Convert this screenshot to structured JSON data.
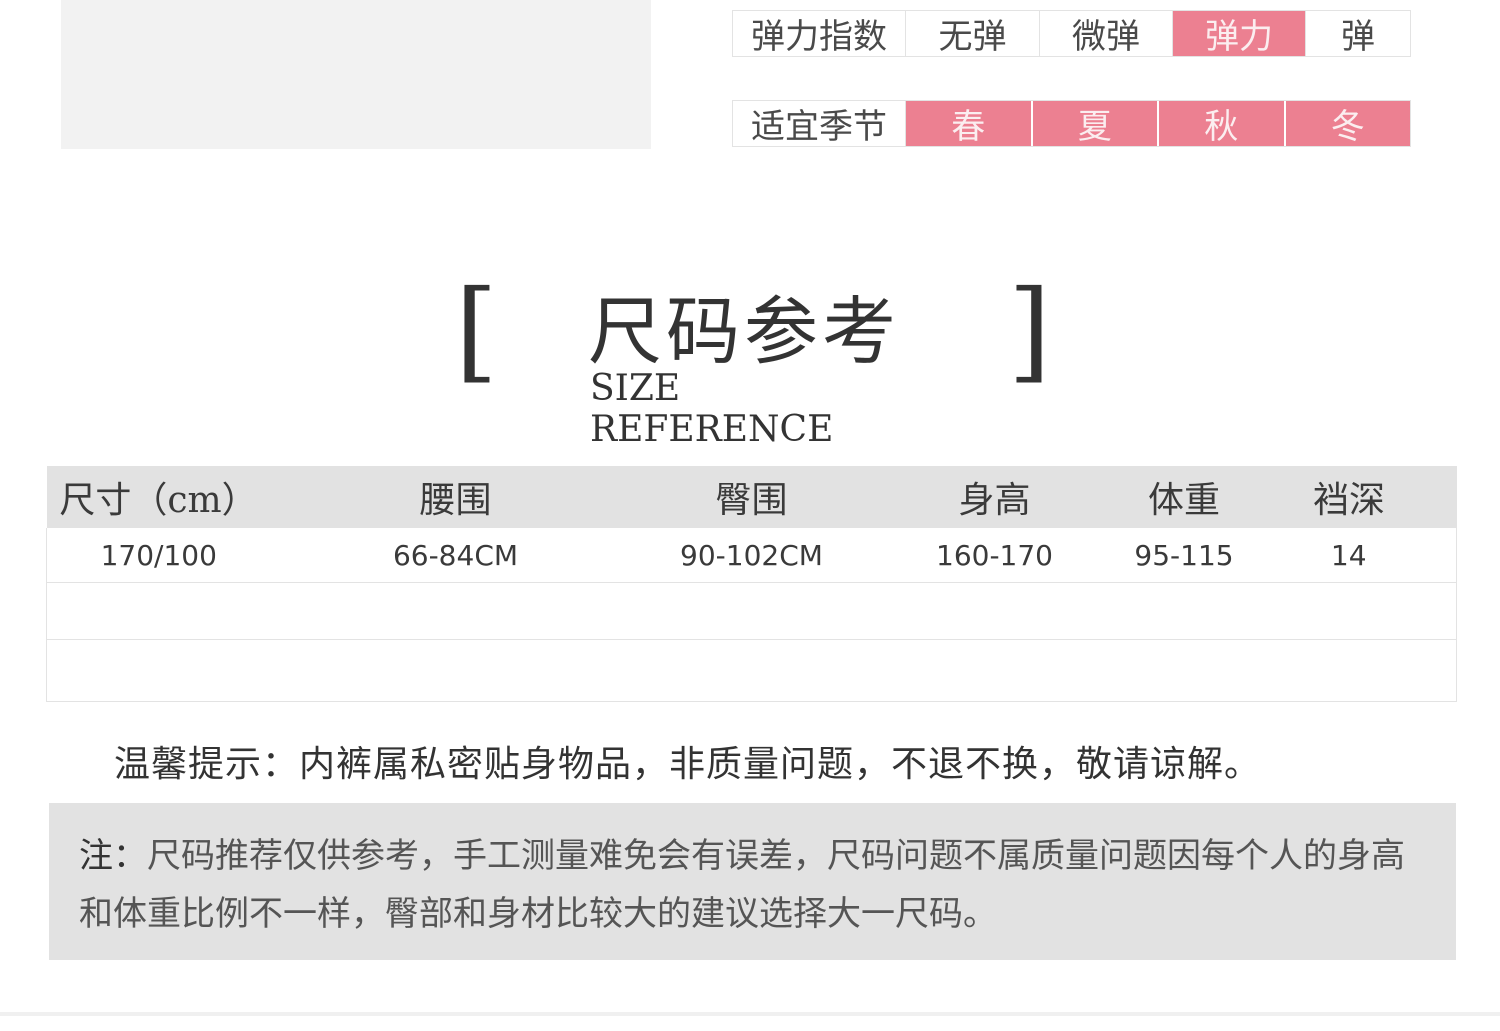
{
  "attributes": {
    "elasticity": {
      "label": "弹力指数",
      "options": [
        "无弹",
        "微弹",
        "弹力",
        "弹"
      ],
      "selected": "弹力"
    },
    "season": {
      "label": "适宜季节",
      "options": [
        "春",
        "夏",
        "秋",
        "冬"
      ]
    },
    "highlight_color": "#ec8091"
  },
  "heading": {
    "left_bracket": "[",
    "right_bracket": "]",
    "title": "尺码参考",
    "subtitle": "SIZE REFERENCE"
  },
  "size_table": {
    "headers": [
      "尺寸（cm）",
      "腰围",
      "臀围",
      "身高",
      "体重",
      "裆深"
    ],
    "rows": [
      [
        "170/100",
        "66-84CM",
        "90-102CM",
        "160-170",
        "95-115",
        "14"
      ]
    ]
  },
  "tip": "温馨提示：内裤属私密贴身物品，非质量问题，不退不换，敬请谅解。",
  "note": {
    "label": "注：",
    "text": "尺码推荐仅供参考，手工测量难免会有误差，尺码问题不属质量问题因每个人的身高和体重比例不一样，臀部和身材比较大的建议选择大一尺码。"
  }
}
